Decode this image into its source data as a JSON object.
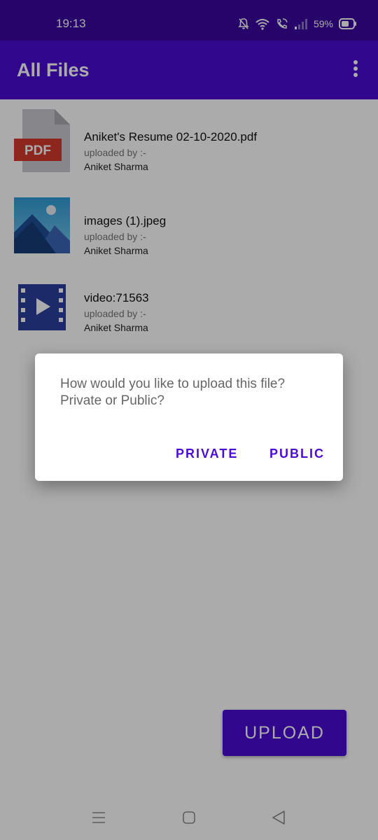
{
  "status_bar": {
    "time": "19:13",
    "battery": "59%"
  },
  "app_bar": {
    "title": "All Files",
    "menu_icon": "more-vert-icon"
  },
  "files": [
    {
      "name": "Aniket's Resume 02-10-2020.pdf",
      "uploaded_by_label": "uploaded by :-",
      "uploader": "Aniket Sharma",
      "icon": "pdf-file-icon",
      "badge": "PDF"
    },
    {
      "name": "images (1).jpeg",
      "uploaded_by_label": "uploaded by :-",
      "uploader": "Aniket Sharma",
      "icon": "image-file-icon"
    },
    {
      "name": "video:71563",
      "uploaded_by_label": "uploaded by :-",
      "uploader": "Aniket Sharma",
      "icon": "video-file-icon"
    }
  ],
  "dialog": {
    "message": "How would you like to upload this file?\nPrivate or Public?",
    "private_label": "PRIVATE",
    "public_label": "PUBLIC"
  },
  "upload_button": "UPLOAD",
  "colors": {
    "primary": "#4a0cd2",
    "status_bar": "#3a079e",
    "accent_text": "#4a0cd2"
  }
}
